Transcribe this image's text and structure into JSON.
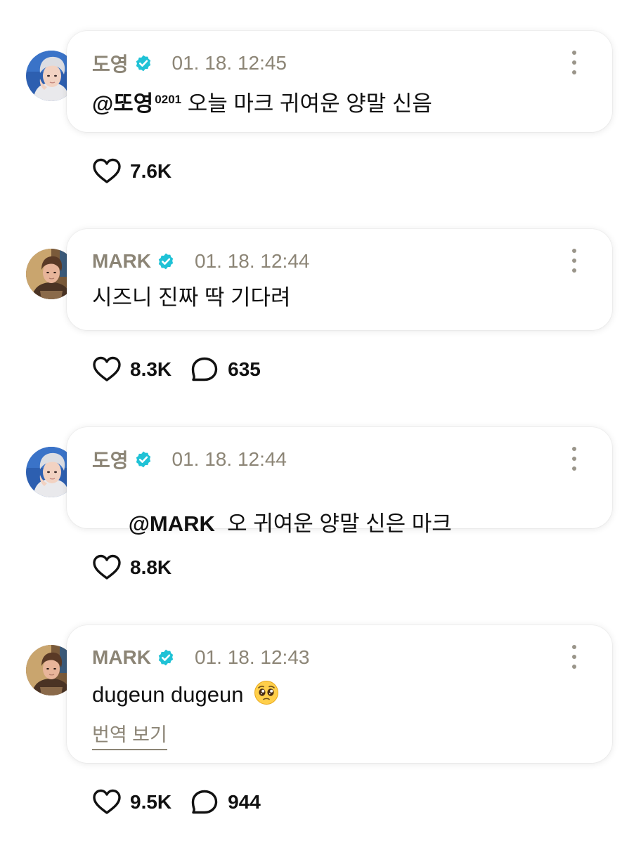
{
  "colors": {
    "meta_text": "#8c8576",
    "verified_badge": "#1fc2d6",
    "body_text": "#111111",
    "bubble_bg": "#ffffff"
  },
  "posts": [
    {
      "author": "도영",
      "time": "01. 18. 12:45",
      "mention": "@또영",
      "mention_sup": "0201",
      "text": " 오늘 마크 귀여운 양말 신음",
      "likes": "7.6K",
      "comments": "",
      "avatar_icon": "doyoung-avatar",
      "verified_icon": "verified-badge-icon"
    },
    {
      "author": "MARK",
      "time": "01. 18. 12:44",
      "mention": "",
      "mention_sup": "",
      "text": "시즈니 진짜 딱 기다려",
      "likes": "8.3K",
      "comments": "635",
      "avatar_icon": "mark-avatar",
      "verified_icon": "verified-badge-icon"
    },
    {
      "author": "도영",
      "time": "01. 18. 12:44",
      "mention": "@MARK",
      "mention_sup": "",
      "text": "  오 귀여운 양말 신은 마크",
      "likes": "8.8K",
      "comments": "",
      "avatar_icon": "doyoung-avatar",
      "verified_icon": "verified-badge-icon"
    },
    {
      "author": "MARK",
      "time": "01. 18. 12:43",
      "mention": "",
      "mention_sup": "",
      "text": "dugeun dugeun ",
      "emoji": "pleading-face-emoji",
      "translate_label": "번역 보기",
      "likes": "9.5K",
      "comments": "944",
      "avatar_icon": "mark-avatar",
      "verified_icon": "verified-badge-icon"
    }
  ]
}
